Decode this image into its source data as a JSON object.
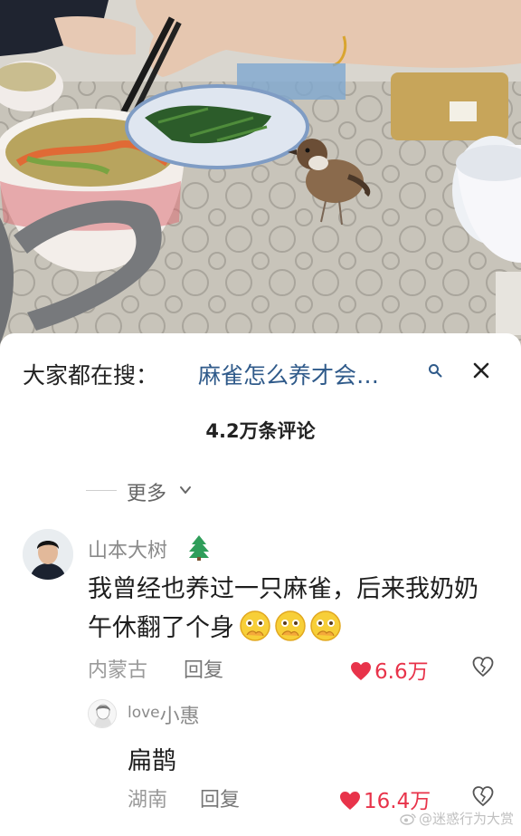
{
  "search": {
    "prefix": "大家都在搜：",
    "query": "麻雀怎么养才会…"
  },
  "comments_header": {
    "count_text": "4.2万条评论"
  },
  "more": {
    "label": "更多"
  },
  "comments": [
    {
      "username": "山本大树",
      "text": "我曾经也养过一只麻雀，后来我奶奶午休翻了个身",
      "location": "内蒙古",
      "reply_label": "回复",
      "likes": "6.6万"
    },
    {
      "username_latin": "love",
      "username_cjk": "小惠",
      "text": "扁鹊",
      "location": "湖南",
      "reply_label": "回复",
      "likes": "16.4万"
    }
  ],
  "icons": {
    "search": "search-icon",
    "close": "close-icon",
    "chevron": "chevron-down-icon",
    "tree": "tree-emoji-icon",
    "emoji": "thinking-face-emoji-icon",
    "heart": "heart-icon",
    "dislike": "broken-heart-icon"
  },
  "colors": {
    "query_link": "#2f5a8a",
    "like_red": "#e8334a",
    "muted_text": "#8a8a8a"
  },
  "watermark": {
    "text": "@迷惑行为大赏"
  }
}
